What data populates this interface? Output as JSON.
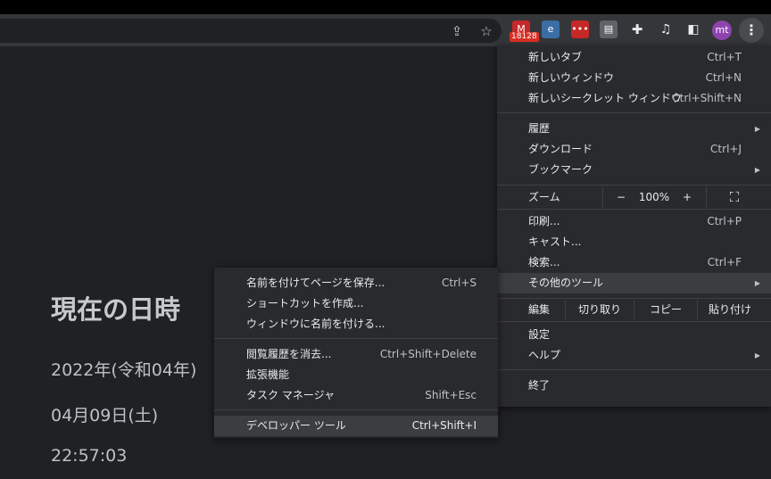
{
  "toolbar": {
    "badge_count": "18128",
    "avatar_initials": "mt",
    "icons": [
      "share-icon",
      "bookmark-star-icon",
      "gmail-extension-icon",
      "extension-icon-2",
      "extension-icon-3",
      "extension-icon-4",
      "extensions-puzzle-icon",
      "media-control-icon",
      "side-panel-icon"
    ]
  },
  "page": {
    "title": "現在の日時",
    "year": "2022年(令和04年)",
    "date": "04月09日(土)",
    "time": "22:57:03"
  },
  "main_menu": {
    "new_tab": {
      "label": "新しいタブ",
      "shortcut": "Ctrl+T"
    },
    "new_window": {
      "label": "新しいウィンドウ",
      "shortcut": "Ctrl+N"
    },
    "incognito": {
      "label": "新しいシークレット ウィンドウ",
      "shortcut": "Ctrl+Shift+N"
    },
    "history": {
      "label": "履歴"
    },
    "downloads": {
      "label": "ダウンロード",
      "shortcut": "Ctrl+J"
    },
    "bookmarks": {
      "label": "ブックマーク"
    },
    "zoom": {
      "label": "ズーム",
      "minus": "−",
      "value": "100%",
      "plus": "+"
    },
    "print": {
      "label": "印刷...",
      "shortcut": "Ctrl+P"
    },
    "cast": {
      "label": "キャスト..."
    },
    "find": {
      "label": "検索...",
      "shortcut": "Ctrl+F"
    },
    "more_tools": {
      "label": "その他のツール"
    },
    "edit": {
      "label": "編集",
      "cut": "切り取り",
      "copy": "コピー",
      "paste": "貼り付け"
    },
    "settings": {
      "label": "設定"
    },
    "help": {
      "label": "ヘルプ"
    },
    "exit": {
      "label": "終了"
    }
  },
  "sub_menu": {
    "save_page": {
      "label": "名前を付けてページを保存...",
      "shortcut": "Ctrl+S"
    },
    "create_shortcut": {
      "label": "ショートカットを作成..."
    },
    "name_window": {
      "label": "ウィンドウに名前を付ける..."
    },
    "clear_data": {
      "label": "閲覧履歴を消去...",
      "shortcut": "Ctrl+Shift+Delete"
    },
    "extensions": {
      "label": "拡張機能"
    },
    "task_manager": {
      "label": "タスク マネージャ",
      "shortcut": "Shift+Esc"
    },
    "dev_tools": {
      "label": "デベロッパー ツール",
      "shortcut": "Ctrl+Shift+I"
    }
  }
}
